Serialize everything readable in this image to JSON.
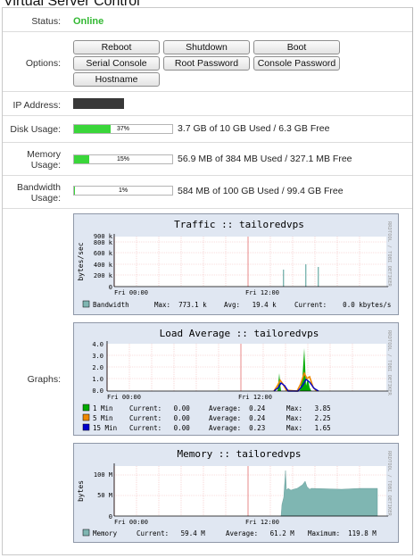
{
  "page": {
    "title": "Virtual Server Control"
  },
  "status": {
    "label": "Status:",
    "value": "Online"
  },
  "options": {
    "label": "Options:",
    "buttons": [
      "Reboot",
      "Shutdown",
      "Boot",
      "Serial Console",
      "Root Password",
      "Console Password",
      "Hostname"
    ]
  },
  "ip": {
    "label": "IP Address:"
  },
  "disk": {
    "label": "Disk Usage:",
    "percent": 37,
    "percent_text": "37%",
    "text": "3.7 GB of 10 GB Used / 6.3 GB Free"
  },
  "memory": {
    "label_line1": "Memory",
    "label_line2": "Usage:",
    "percent": 15,
    "percent_text": "15%",
    "text": "56.9 MB of 384 MB Used / 327.1 MB Free"
  },
  "bandwidth": {
    "label_line1": "Bandwidth",
    "label_line2": "Usage:",
    "percent": 1,
    "percent_text": "1%",
    "text": "584 MB of 100 GB Used / 99.4 GB Free"
  },
  "graphs_label": "Graphs:",
  "side_text": "RRDTOOL / TOBI OETIKER",
  "colors": {
    "online": "#33b833",
    "bar": "#3ad63a",
    "graph_bg": "#e0e7f2",
    "line1": "#00aa00",
    "line5": "#ee8800",
    "line15": "#0000cc",
    "area": "#7fb6b2"
  },
  "traffic": {
    "title": "Traffic :: tailoredvps",
    "ylabel": "bytes/sec",
    "yticks": [
      "900 k",
      "800 k",
      "600 k",
      "400 k",
      "200 k",
      "0"
    ],
    "xticks": [
      "Fri 00:00",
      "Fri 12:00"
    ],
    "legend": {
      "name": "Bandwidth",
      "max": "Max:  773.1 k",
      "avg": "Avg:   19.4 k",
      "current": "Current:    0.0 kbytes/s"
    }
  },
  "load": {
    "title": "Load Average :: tailoredvps",
    "yticks": [
      "4.0",
      "3.0",
      "2.0",
      "1.0",
      "0.0"
    ],
    "xticks": [
      "Fri 00:00",
      "Fri 12:00"
    ],
    "legend": [
      {
        "name": "1 Min",
        "current": "Current:   0.00",
        "average": "Average:  0.24",
        "max": "Max:   3.85"
      },
      {
        "name": "5 Min",
        "current": "Current:   0.00",
        "average": "Average:  0.24",
        "max": "Max:   2.25"
      },
      {
        "name": "15 Min",
        "current": "Current:   0.00",
        "average": "Average:  0.23",
        "max": "Max:   1.65"
      }
    ]
  },
  "memgraph": {
    "title": "Memory :: tailoredvps",
    "ylabel": "bytes",
    "yticks": [
      "100 M",
      "50 M",
      "0"
    ],
    "xticks": [
      "Fri 00:00",
      "Fri 12:00"
    ],
    "legend": {
      "name": "Memory",
      "current": "Current:   59.4 M",
      "average": "Average:   61.2 M",
      "max": "Maximum:  119.8 M"
    }
  }
}
